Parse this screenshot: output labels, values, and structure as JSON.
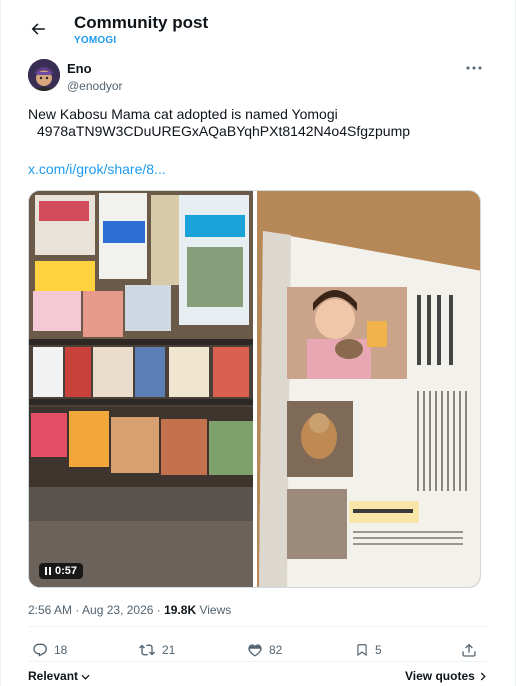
{
  "header": {
    "title": "Community post",
    "community": "YOMOGI"
  },
  "author": {
    "name": "Eno",
    "handle": "@enodyor"
  },
  "post": {
    "text": "New Kabosu Mama cat adopted is named Yomogi",
    "contract": "4978aTN9W3CDuUREGxAQaBYqhPXt8142N4o4Sfgzpump",
    "link": "x.com/i/grok/share/8..."
  },
  "media": {
    "video_time": "0:57",
    "left_image": "magazine shelf with pet magazines",
    "right_image": "magazine page with woman holding a cat"
  },
  "meta": {
    "timestamp": "2:56 AM · Aug 23, 2026 · ",
    "views_count": "19.8K",
    "views_label": " Views"
  },
  "actions": {
    "replies": "18",
    "reposts": "21",
    "likes": "82",
    "bookmarks": "5"
  },
  "footer": {
    "sort": "Relevant",
    "view_quotes": "View quotes"
  },
  "colors": {
    "accent": "#1d9bf0",
    "text": "#0f1419",
    "muted": "#536471"
  }
}
